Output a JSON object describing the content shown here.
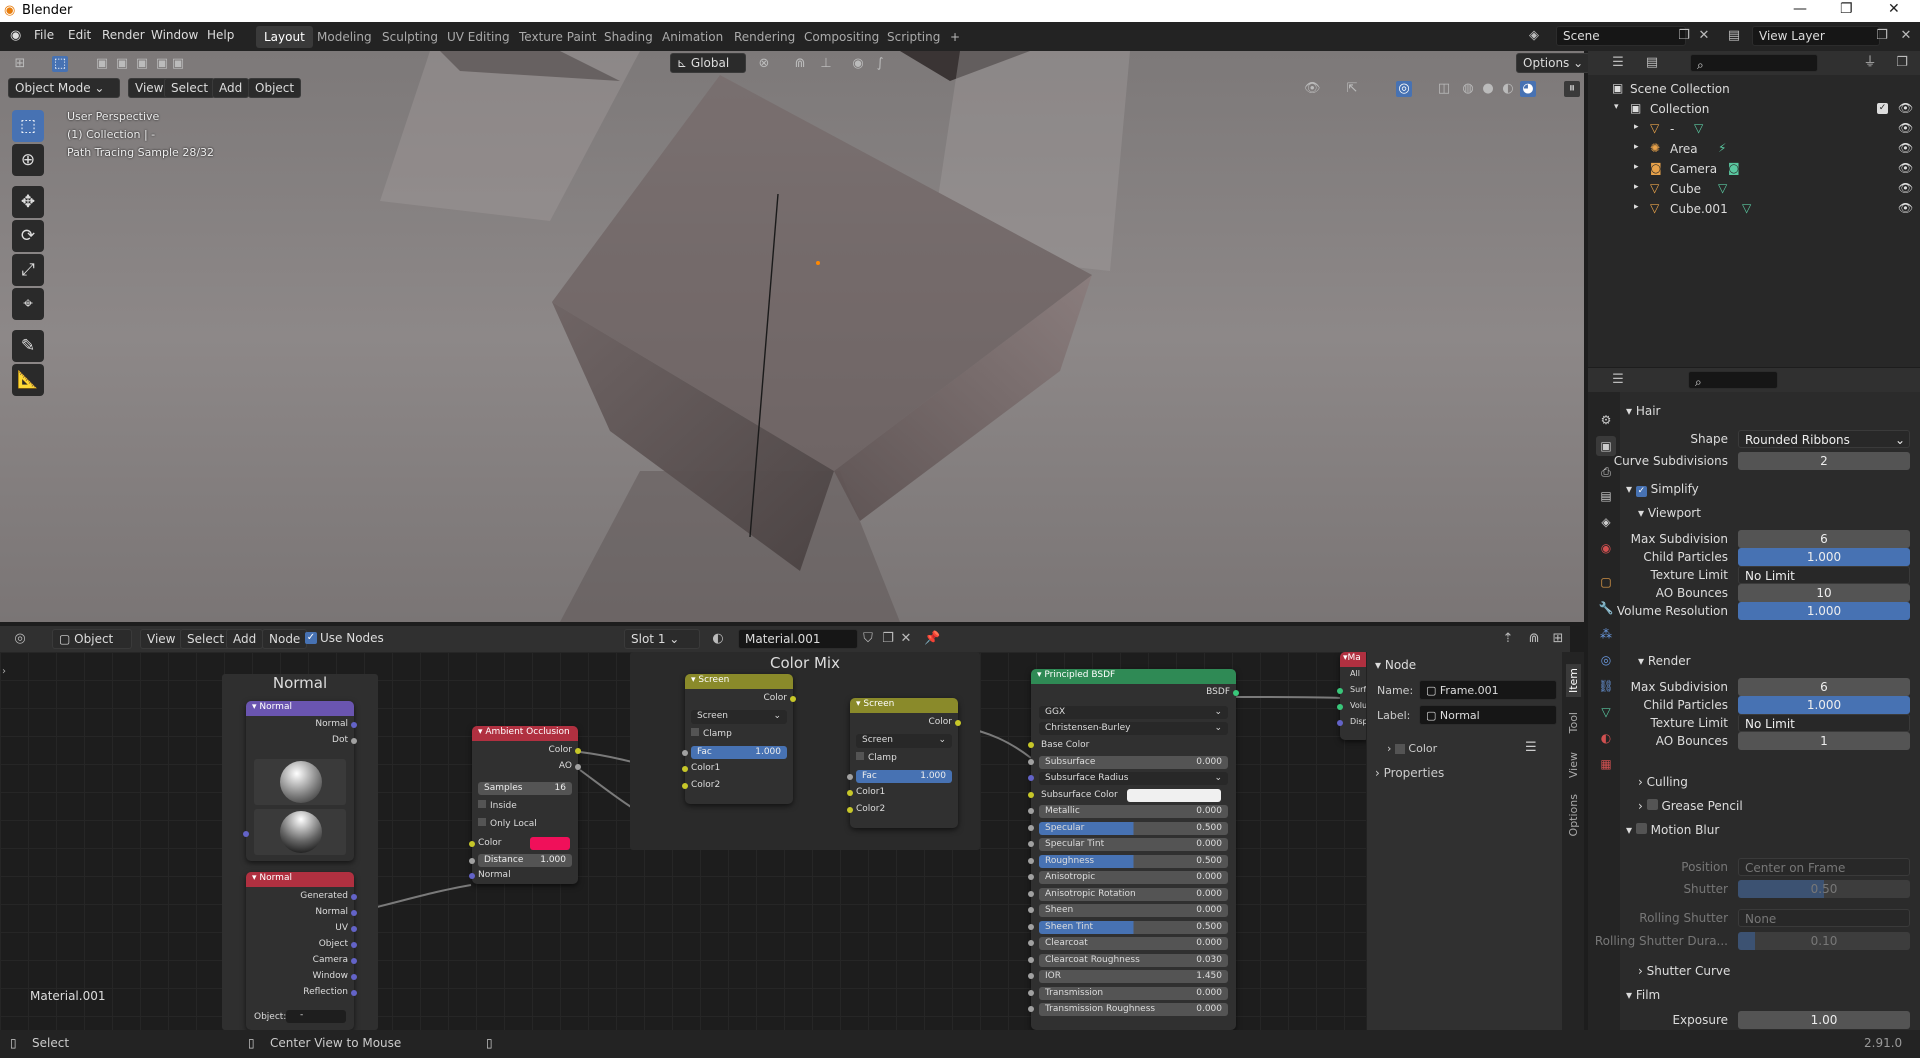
{
  "window": {
    "title": "Blender",
    "icon": "blender-logo-icon"
  },
  "menus": [
    "File",
    "Edit",
    "Render",
    "Window",
    "Help"
  ],
  "workspaces": [
    "Layout",
    "Modeling",
    "Sculpting",
    "UV Editing",
    "Texture Paint",
    "Shading",
    "Animation",
    "Rendering",
    "Compositing",
    "Scripting"
  ],
  "scene": "Scene",
  "view_layer": "View Layer",
  "viewport": {
    "transform_orientation": "Global",
    "options_label": "Options",
    "mode": "Object Mode",
    "menus": [
      "View",
      "Select",
      "Add",
      "Object"
    ],
    "overlay_lines": [
      "User Perspective",
      "(1) Collection | -",
      "Path Tracing Sample 28/32"
    ]
  },
  "node_editor": {
    "editor_type": "Object",
    "menus": [
      "View",
      "Select",
      "Add",
      "Node"
    ],
    "use_nodes": "Use Nodes",
    "slot": "Slot 1",
    "material": "Material.001",
    "corner_label": "Material.001",
    "frames": {
      "normal": "Normal",
      "color_mix": "Color Mix"
    },
    "normal_node": {
      "title": "Normal",
      "outputs": [
        "Normal",
        "Dot"
      ]
    },
    "texcoord_node": {
      "title": "Normal",
      "outputs": [
        "Generated",
        "Normal",
        "UV",
        "Object",
        "Camera",
        "Window",
        "Reflection"
      ],
      "object_label": "Object:",
      "object_value": "-"
    },
    "ao_node": {
      "title": "Ambient Occlusion",
      "outputs": [
        "Color",
        "AO"
      ],
      "samples_label": "Samples",
      "samples": "16",
      "inside": "Inside",
      "only_local": "Only Local",
      "color_label": "Color",
      "distance_label": "Distance",
      "distance": "1.000",
      "normal_label": "Normal",
      "color_swatch": "#f0105a"
    },
    "mix1": {
      "title": "Screen",
      "output": "Color",
      "blend": "Screen",
      "clamp": "Clamp",
      "fac_label": "Fac",
      "fac": "1.000",
      "inputs": [
        "Color1",
        "Color2"
      ]
    },
    "mix2": {
      "title": "Screen",
      "output": "Color",
      "blend": "Screen",
      "clamp": "Clamp",
      "fac_label": "Fac",
      "fac": "1.000",
      "inputs": [
        "Color1",
        "Color2"
      ]
    },
    "bsdf": {
      "title": "Principled BSDF",
      "output": "BSDF",
      "distribution": "GGX",
      "subsurface_method": "Christensen-Burley",
      "rows": [
        {
          "label": "Base Color",
          "value": ""
        },
        {
          "label": "Subsurface",
          "value": "0.000"
        },
        {
          "label": "Subsurface Radius",
          "value": ""
        },
        {
          "label": "Subsurface Color",
          "value": ""
        },
        {
          "label": "Metallic",
          "value": "0.000"
        },
        {
          "label": "Specular",
          "value": "0.500"
        },
        {
          "label": "Specular Tint",
          "value": "0.000"
        },
        {
          "label": "Roughness",
          "value": "0.500"
        },
        {
          "label": "Anisotropic",
          "value": "0.000"
        },
        {
          "label": "Anisotropic Rotation",
          "value": "0.000"
        },
        {
          "label": "Sheen",
          "value": "0.000"
        },
        {
          "label": "Sheen Tint",
          "value": "0.500"
        },
        {
          "label": "Clearcoat",
          "value": "0.000"
        },
        {
          "label": "Clearcoat Roughness",
          "value": "0.030"
        },
        {
          "label": "IOR",
          "value": "1.450"
        },
        {
          "label": "Transmission",
          "value": "0.000"
        },
        {
          "label": "Transmission Roughness",
          "value": "0.000"
        }
      ]
    },
    "output_node": {
      "title": "Ma",
      "rows": [
        "All",
        "Surf",
        "Volu",
        "Disp"
      ]
    },
    "sidebar": {
      "section": "Node",
      "name_label": "Name:",
      "name": "Frame.001",
      "label_label": "Label:",
      "label": "Normal",
      "color": "Color",
      "properties": "Properties",
      "tabs": [
        "Item",
        "Tool",
        "View",
        "Options"
      ]
    }
  },
  "outliner": {
    "root": "Scene Collection",
    "collection": "Collection",
    "items": [
      {
        "name": "-"
      },
      {
        "name": "Area"
      },
      {
        "name": "Camera"
      },
      {
        "name": "Cube"
      },
      {
        "name": "Cube.001"
      }
    ]
  },
  "properties": {
    "hair": {
      "title": "Hair",
      "shape_label": "Shape",
      "shape": "Rounded Ribbons",
      "curve_label": "Curve Subdivisions",
      "curve": "2"
    },
    "simplify": {
      "title": "Simplify",
      "viewport": {
        "title": "Viewport",
        "rows": [
          [
            "Max Subdivision",
            "6"
          ],
          [
            "Child Particles",
            "1.000"
          ],
          [
            "Texture Limit",
            "No Limit"
          ],
          [
            "AO Bounces",
            "10"
          ],
          [
            "Volume Resolution",
            "1.000"
          ]
        ]
      },
      "render": {
        "title": "Render",
        "rows": [
          [
            "Max Subdivision",
            "6"
          ],
          [
            "Child Particles",
            "1.000"
          ],
          [
            "Texture Limit",
            "No Limit"
          ],
          [
            "AO Bounces",
            "1"
          ]
        ]
      },
      "culling": "Culling",
      "grease_pencil": "Grease Pencil"
    },
    "motion_blur": {
      "title": "Motion Blur",
      "rows": [
        [
          "Position",
          "Center on Frame"
        ],
        [
          "Shutter",
          "0.50"
        ],
        [
          "Rolling Shutter",
          "None"
        ],
        [
          "Rolling Shutter Dura...",
          "0.10"
        ]
      ],
      "shutter_curve": "Shutter Curve"
    },
    "film": {
      "title": "Film",
      "exposure_label": "Exposure",
      "exposure": "1.00"
    }
  },
  "status": {
    "left": "Select",
    "middle": "Center View to Mouse",
    "version": "2.91.0"
  }
}
